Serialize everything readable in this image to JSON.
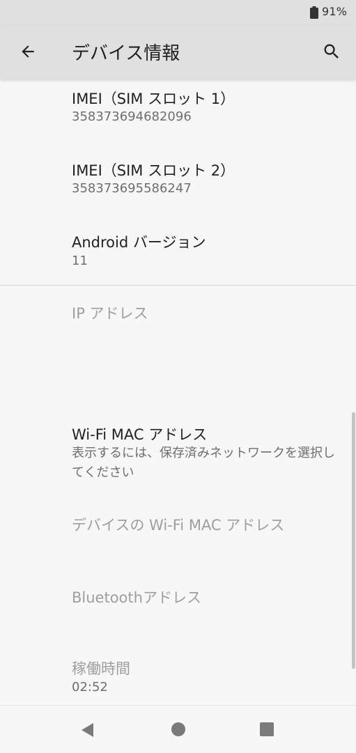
{
  "status_bar": {
    "battery_icon": "battery-icon",
    "battery_text": "91%"
  },
  "app_bar": {
    "title": "デバイス情報",
    "back_icon": "arrow-back-icon",
    "search_icon": "search-icon"
  },
  "items": [
    {
      "title": "IMEI（SIM スロット 1）",
      "summary": "358373694682096"
    },
    {
      "title": "IMEI（SIM スロット 2）",
      "summary": "358373695586247"
    },
    {
      "title": "Android バージョン",
      "summary": "11"
    },
    {
      "title": "IP アドレス",
      "summary": ""
    },
    {
      "title": "Wi-Fi MAC アドレス",
      "summary": "表示するには、保存済みネットワークを選択してください"
    },
    {
      "title": "デバイスの Wi-Fi MAC アドレス",
      "summary": ""
    },
    {
      "title": "Bluetoothアドレス",
      "summary": ""
    },
    {
      "title": "稼働時間",
      "summary": "02:52"
    }
  ],
  "nav_bar": {
    "back_icon": "nav-back-icon",
    "home_icon": "nav-home-icon",
    "recents_icon": "nav-recents-icon"
  },
  "colors": {
    "app_bar_bg": "#e0e0e0",
    "content_bg": "#f7f7f7",
    "primary_text": "#212121",
    "secondary_text": "#6e6e6e",
    "disabled_text": "#9e9e9e"
  }
}
